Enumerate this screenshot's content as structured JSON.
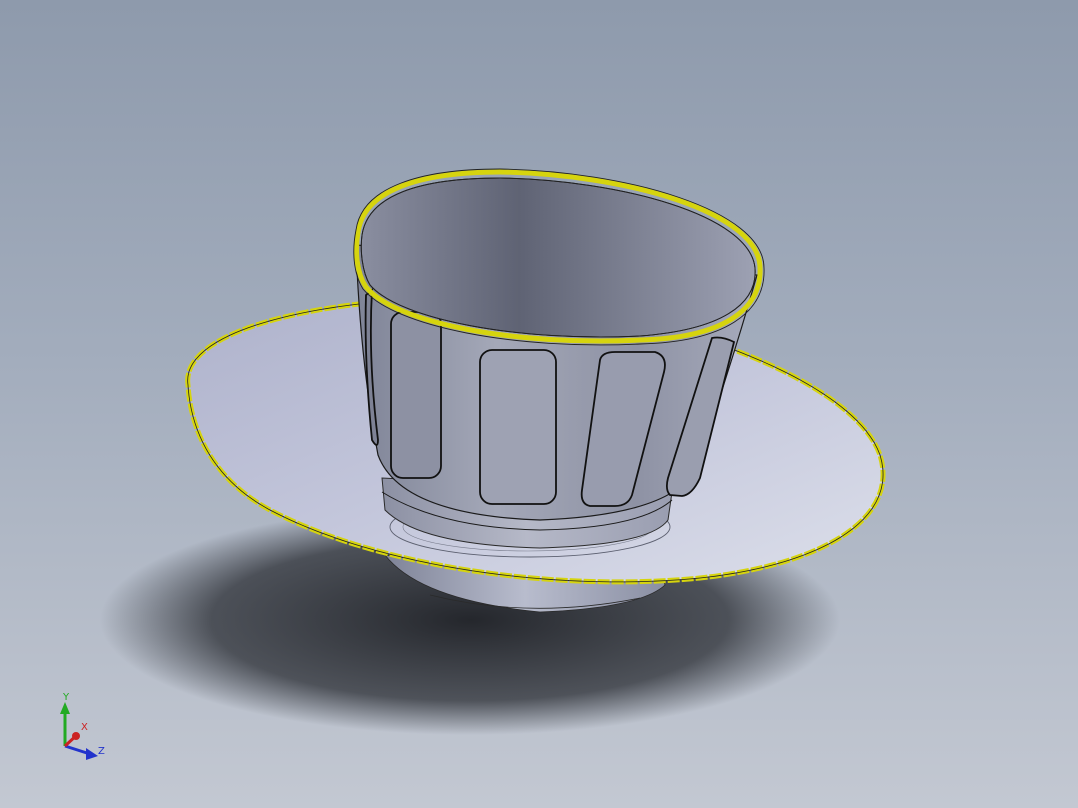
{
  "viewport": {
    "background_top": "#8e9aac",
    "background_bottom": "#c3c8d2"
  },
  "model": {
    "highlight_color": "#d6d40e",
    "edge_color": "#1a1a1a",
    "body_color": "#9aa0b2"
  },
  "triad": {
    "y_label": "Y",
    "x_label": "X",
    "z_label": "Z",
    "y_color": "#22aa22",
    "x_color": "#cc2222",
    "z_color": "#2233cc"
  }
}
